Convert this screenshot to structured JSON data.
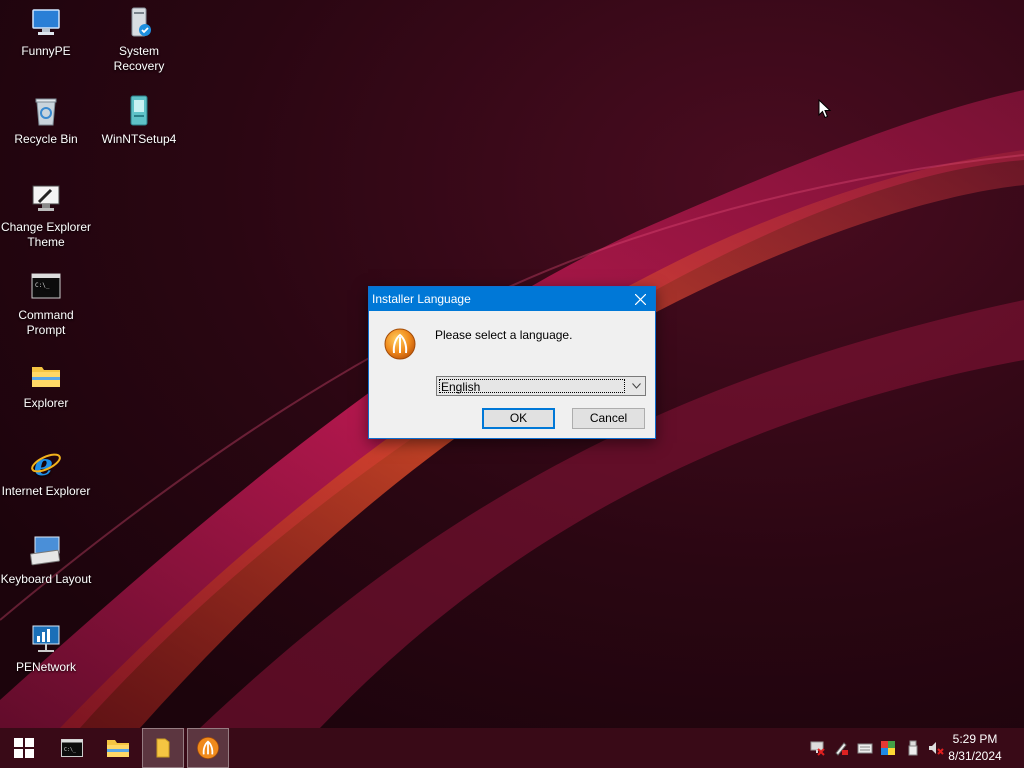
{
  "desktop": {
    "icons": [
      {
        "label": "FunnyPE",
        "icon": "computer-icon"
      },
      {
        "label": "System Recovery",
        "icon": "system-recovery-icon"
      },
      {
        "label": "Recycle Bin",
        "icon": "recycle-bin-icon"
      },
      {
        "label": "WinNTSetup4",
        "icon": "winntsetup-icon"
      },
      {
        "label": "Change Explorer Theme",
        "icon": "monitor-brush-icon"
      },
      {
        "label": "Command Prompt",
        "icon": "cmd-icon"
      },
      {
        "label": "Explorer",
        "icon": "folder-icon"
      },
      {
        "label": "Internet Explorer",
        "icon": "ie-icon"
      },
      {
        "label": "Keyboard Layout",
        "icon": "keyboard-icon"
      },
      {
        "label": "PENetwork",
        "icon": "network-icon"
      }
    ]
  },
  "dialog": {
    "title": "Installer Language",
    "message": "Please select a language.",
    "language_selected": "English",
    "ok_label": "OK",
    "cancel_label": "Cancel"
  },
  "taskbar": {
    "items": [
      "start-icon",
      "cmd-icon",
      "file-explorer-icon",
      "folder-icon",
      "installer-icon"
    ],
    "tray": [
      "network-icon",
      "pen-icon",
      "keyboard-icon",
      "color-icon",
      "usb-icon",
      "volume-muted-icon"
    ],
    "time": "5:29 PM",
    "date": "8/31/2024"
  },
  "colors": {
    "accent": "#0078d7",
    "wallpaper_base": "#2a0612",
    "wave": "#c01a4e"
  }
}
